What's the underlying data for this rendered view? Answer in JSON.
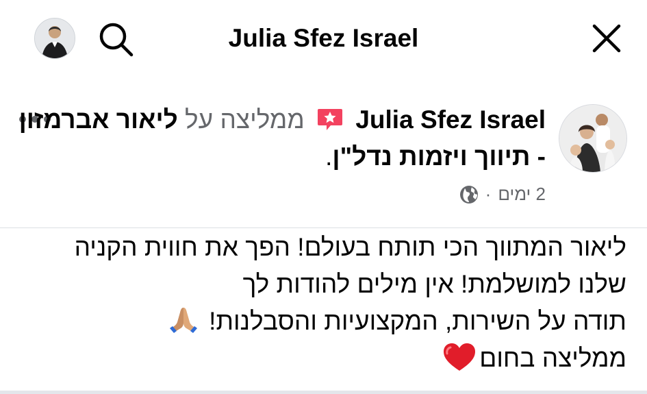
{
  "topbar": {
    "title": "Julia Sfez Israel",
    "avatar_icon": "user-avatar-icon",
    "search_icon": "search-icon",
    "close_icon": "close-icon"
  },
  "post": {
    "author": "Julia Sfez Israel",
    "recommends_text": "ממליצה על",
    "page_name": "ליאור אברמזון - תיווך ויזמות נדל\"ן",
    "period": ".",
    "time": "2 ימים",
    "separator": "·",
    "audience_icon": "globe-icon",
    "more_icon": "more-options-icon",
    "recommend_badge_icon": "recommend-badge-icon",
    "body_lines": [
      "ליאור המתווך הכי תותח בעולם! הפך את חווית הקניה",
      "שלנו למושלמת! אין מילים להודות לך",
      "תודה על השירות, המקצועיות והסבלנות!",
      "ממליצה בחום"
    ],
    "emoji_line3": "folded-hands-icon",
    "emoji_line4": "red-heart-icon"
  },
  "colors": {
    "text": "#050505",
    "secondary": "#65676b",
    "badge": "#f3425f",
    "heart": "#e11d2a"
  }
}
